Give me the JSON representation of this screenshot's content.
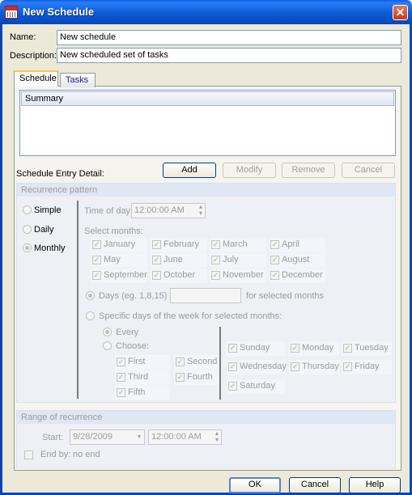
{
  "window": {
    "title": "New Schedule",
    "close_glyph": "✕"
  },
  "form": {
    "name_label": "Name:",
    "name_value": "New schedule",
    "description_label": "Description:",
    "description_value": "New scheduled set of tasks"
  },
  "tabs": [
    {
      "label": "Schedule",
      "active": true
    },
    {
      "label": "Tasks",
      "active": false
    }
  ],
  "summary": {
    "header": "Summary"
  },
  "entry": {
    "label": "Schedule Entry Detail:",
    "buttons": {
      "add": "Add",
      "modify": "Modify",
      "remove": "Remove",
      "cancel": "Cancel"
    }
  },
  "recurrence": {
    "title": "Recurrence pattern",
    "types": [
      {
        "label": "Simple",
        "selected": false
      },
      {
        "label": "Daily",
        "selected": false
      },
      {
        "label": "Monthly",
        "selected": true
      }
    ],
    "time_label": "Time of day:",
    "time_value": "12:00:00 AM",
    "select_months_label": "Select months:",
    "months": [
      "January",
      "February",
      "March",
      "April",
      "May",
      "June",
      "July",
      "August",
      "September",
      "October",
      "November",
      "December"
    ],
    "days_option_label": "Days (eg. 1,8,15)",
    "days_value": "",
    "days_suffix": "for selected months",
    "specific_label": "Specific days of the week for selected months:",
    "every_label": "Every",
    "choose_label": "Choose:",
    "ordinals": [
      "First",
      "Second",
      "Third",
      "Fourth",
      "Fifth"
    ],
    "weekdays": [
      "Sunday",
      "Monday",
      "Tuesday",
      "Wednesday",
      "Thursday",
      "Friday",
      "Saturday"
    ]
  },
  "range": {
    "title": "Range of recurrence",
    "start_label": "Start:",
    "start_date": "9/28/2009",
    "start_time": "12:00:00 AM",
    "end_label": "End by:",
    "end_value": "no end"
  },
  "footer": {
    "ok": "OK",
    "cancel": "Cancel",
    "help": "Help"
  },
  "colors": {
    "titlebar": "#0b5bd8",
    "dialog_bg": "#ece9d8",
    "group_bg": "#eef0f6"
  }
}
